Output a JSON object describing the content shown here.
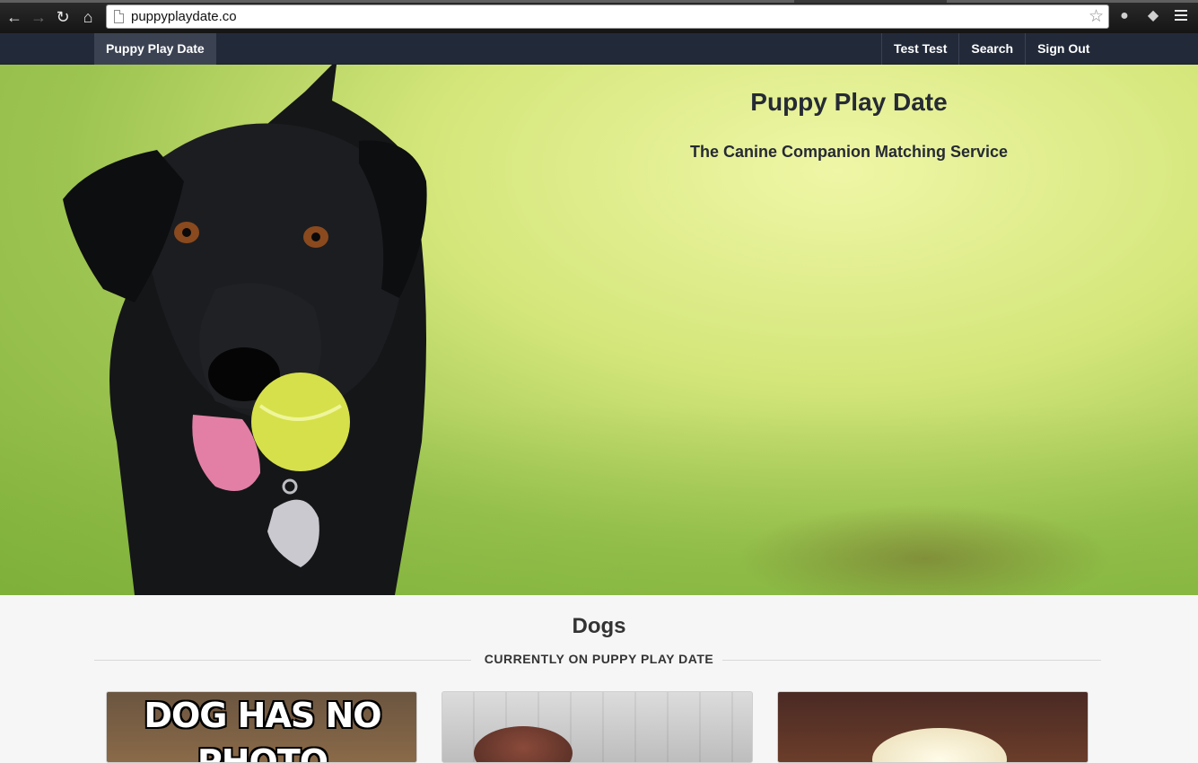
{
  "browser": {
    "url": "puppyplaydate.co"
  },
  "navbar": {
    "brand": "Puppy Play Date",
    "links": [
      "Test Test",
      "Search",
      "Sign Out"
    ]
  },
  "hero": {
    "title": "Puppy Play Date",
    "subtitle": "The Canine Companion Matching Service"
  },
  "dogs": {
    "heading": "Dogs",
    "subheading": "CURRENTLY ON PUPPY PLAY DATE",
    "cards": [
      {
        "meme_text": "DOG HAS NO PHOTO"
      },
      {
        "meme_text": ""
      },
      {
        "meme_text": ""
      }
    ]
  },
  "colors": {
    "navbar": "#222a3a",
    "brand_active": "#3b4353",
    "page_bg": "#f6f6f6"
  }
}
